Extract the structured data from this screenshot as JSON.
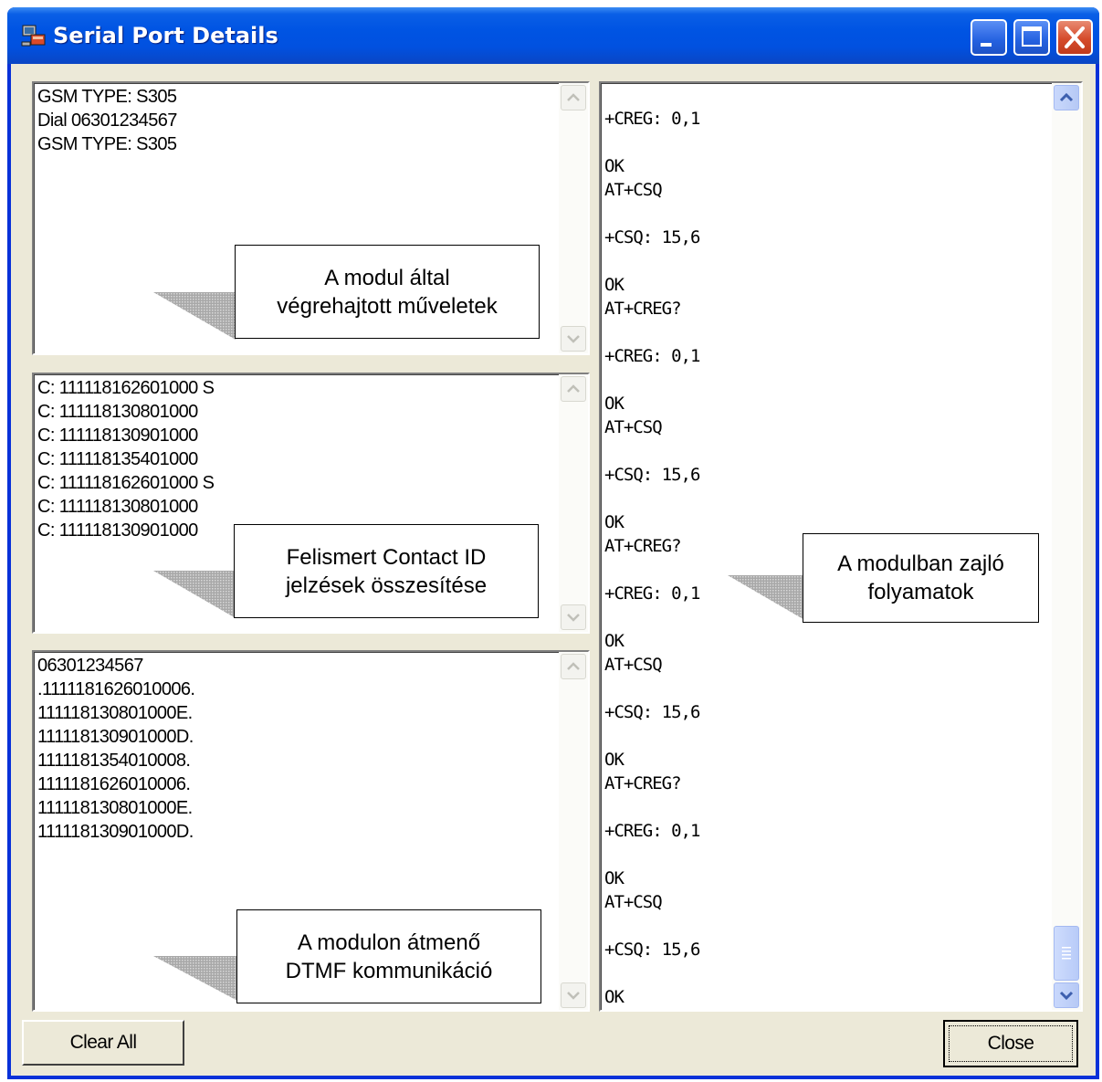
{
  "window": {
    "title": "Serial Port Details"
  },
  "panels": {
    "actions": {
      "lines": [
        "GSM TYPE: S305",
        "Dial 06301234567",
        "GSM TYPE: S305"
      ]
    },
    "contact_ids": {
      "lines": [
        "C: 111118162601000 S",
        "C: 111118130801000",
        "C: 111118130901000",
        "C: 111118135401000",
        "C: 111118162601000 S",
        "C: 111118130801000",
        "C: 111118130901000"
      ]
    },
    "dtmf": {
      "lines": [
        "06301234567",
        ".1111181626010006.",
        "111118130801000E.",
        "111118130901000D.",
        "1111181354010008.",
        "1111181626010006.",
        "111118130801000E.",
        "111118130901000D."
      ]
    },
    "module_log": {
      "lines": [
        "",
        "+CREG: 0,1",
        "",
        "OK",
        "AT+CSQ",
        "",
        "+CSQ: 15,6",
        "",
        "OK",
        "AT+CREG?",
        "",
        "+CREG: 0,1",
        "",
        "OK",
        "AT+CSQ",
        "",
        "+CSQ: 15,6",
        "",
        "OK",
        "AT+CREG?",
        "",
        "+CREG: 0,1",
        "",
        "OK",
        "AT+CSQ",
        "",
        "+CSQ: 15,6",
        "",
        "OK",
        "AT+CREG?",
        "",
        "+CREG: 0,1",
        "",
        "OK",
        "AT+CSQ",
        "",
        "+CSQ: 15,6",
        "",
        "OK"
      ]
    }
  },
  "callouts": {
    "actions": [
      "A modul által",
      "végrehajtott műveletek"
    ],
    "contact_ids": [
      "Felismert Contact ID",
      "jelzések összesítése"
    ],
    "dtmf": [
      "A modulon átmenő",
      "DTMF kommunikáció"
    ],
    "module_log": [
      "A modulban zajló",
      "folyamatok"
    ]
  },
  "buttons": {
    "clear_all": "Clear All",
    "close": "Close"
  },
  "icons": {
    "app": "serial-port-app-icon",
    "minimize": "minimize-icon",
    "maximize": "maximize-icon",
    "close": "close-icon",
    "scroll_up": "scroll-up-arrow-icon",
    "scroll_down": "scroll-down-arrow-icon",
    "scroll_grip": "scroll-grip-icon"
  },
  "colors": {
    "titlebar": "#0054e3",
    "close_button": "#d54b2b",
    "dialog_face": "#ece9d8",
    "scroll_active": "#b6c9f5"
  }
}
